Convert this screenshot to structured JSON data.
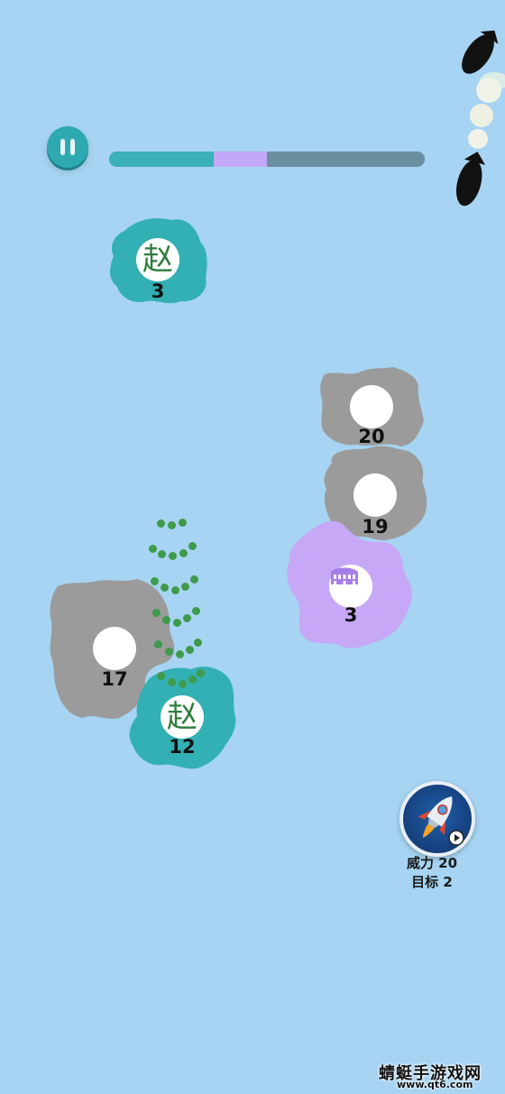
{
  "hud": {
    "pause_icon": "pause-icon",
    "progress": {
      "segments": [
        {
          "name": "teal",
          "fraction": 0.33,
          "color": "#3bb0b8"
        },
        {
          "name": "purple",
          "fraction": 0.17,
          "color": "#c2a8f6"
        },
        {
          "name": "remaining",
          "fraction": 0.5,
          "color": "#6a8fa0"
        }
      ]
    }
  },
  "colors": {
    "teal": "#33b0b3",
    "gray": "#9b9b9b",
    "purple": "#c7a8f7",
    "ocean": "#a6d4f2"
  },
  "islands": [
    {
      "id": "zhao-top",
      "owner": "teal",
      "glyph": "赵",
      "count": "3"
    },
    {
      "id": "gray-20",
      "owner": "gray",
      "glyph": "",
      "count": "20"
    },
    {
      "id": "gray-19",
      "owner": "gray",
      "glyph": "",
      "count": "19"
    },
    {
      "id": "rome",
      "owner": "purple",
      "glyph": "colosseum-icon",
      "count": "3"
    },
    {
      "id": "gray-17",
      "owner": "gray",
      "glyph": "",
      "count": "17"
    },
    {
      "id": "zhao-bottom",
      "owner": "teal",
      "glyph": "赵",
      "count": "12"
    }
  ],
  "rocket": {
    "icon": "rocket-icon",
    "power_label": "威力 20",
    "target_label": "目标 2"
  },
  "watermark": {
    "title": "蜻蜓手游戏网",
    "url": "www.qt6.com"
  }
}
